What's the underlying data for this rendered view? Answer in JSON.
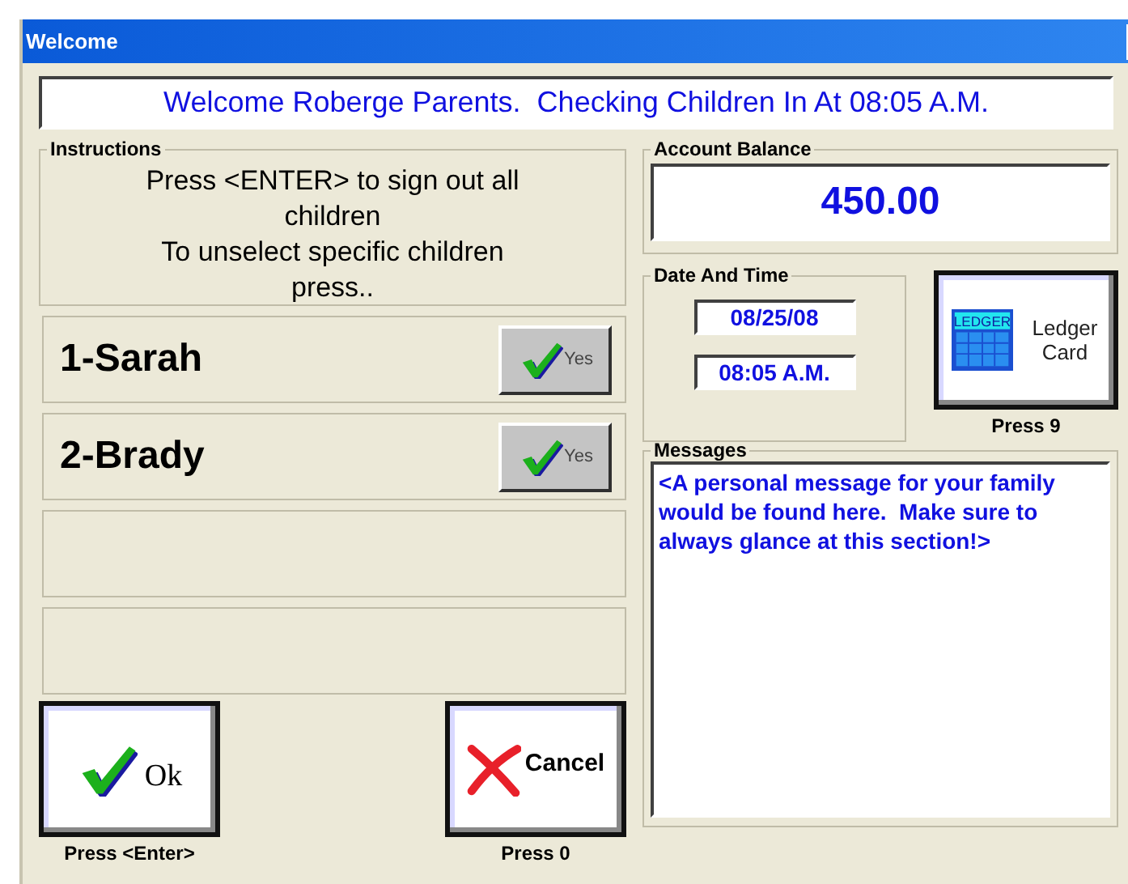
{
  "window": {
    "title": "Welcome"
  },
  "banner": "Welcome Roberge Parents.  Checking Children In At 08:05 A.M.",
  "instructions": {
    "title": "Instructions",
    "lines": [
      "Press <ENTER> to sign out all children",
      "To unselect specific children press.."
    ]
  },
  "children": [
    {
      "kind": "child",
      "name": "1-Sarah",
      "button": "Yes",
      "selected": true
    },
    {
      "kind": "child",
      "name": "2-Brady",
      "button": "Yes",
      "selected": true
    },
    {
      "kind": "empty"
    },
    {
      "kind": "empty"
    }
  ],
  "ok_button": {
    "label": "Ok",
    "hint": "Press <Enter>"
  },
  "cancel_button": {
    "label": "Cancel",
    "hint": "Press 0"
  },
  "account_balance": {
    "title": "Account Balance",
    "value": "450.00"
  },
  "date_and_time": {
    "title": "Date And Time",
    "date": "08/25/08",
    "time": "08:05 A.M."
  },
  "ledger_button": {
    "icon_text": "LEDGER",
    "label": "Ledger Card",
    "hint": "Press 9"
  },
  "messages": {
    "title": "Messages",
    "text": "<A personal message for your family would be found here.  Make sure to always glance at this section!>"
  }
}
